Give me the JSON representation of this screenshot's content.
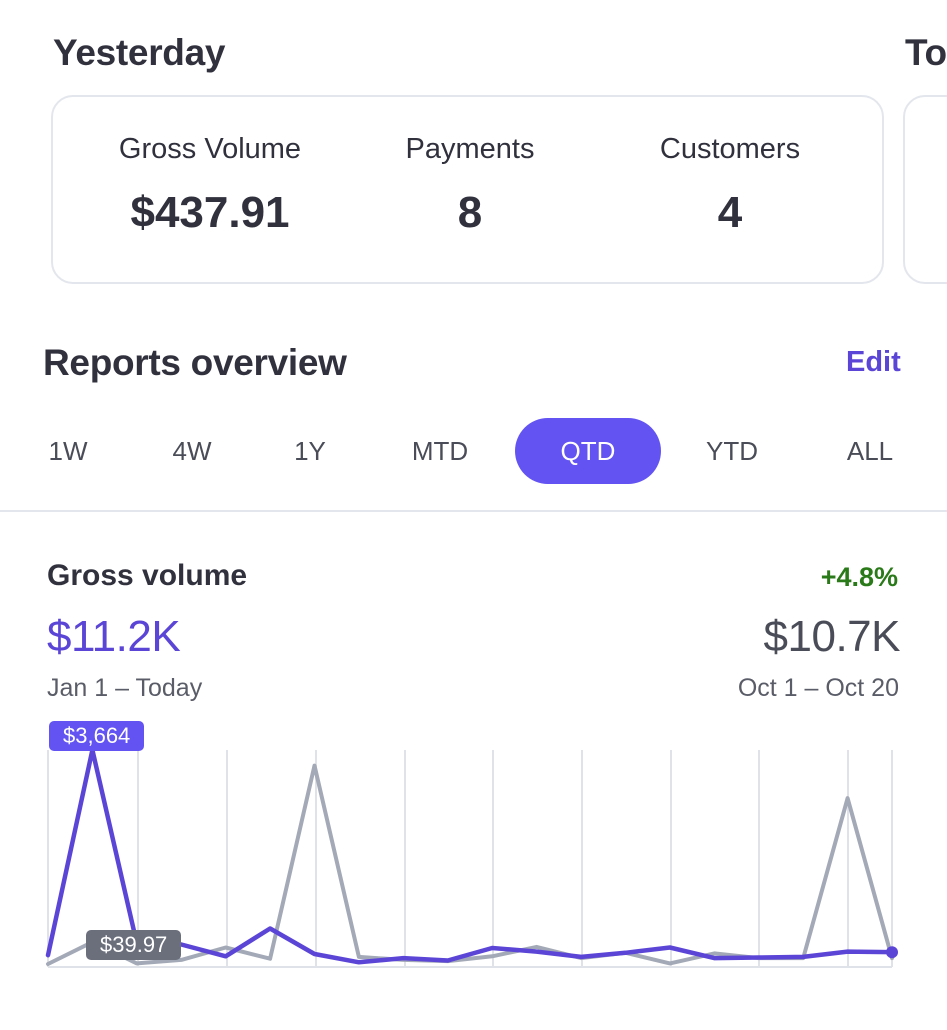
{
  "yesterday": {
    "title": "Yesterday",
    "next_title_peek": "To",
    "metrics": [
      {
        "label": "Gross Volume",
        "value": "$437.91"
      },
      {
        "label": "Payments",
        "value": "8"
      },
      {
        "label": "Customers",
        "value": "4"
      }
    ]
  },
  "reports": {
    "title": "Reports overview",
    "edit_label": "Edit",
    "tabs": [
      "1W",
      "4W",
      "1Y",
      "MTD",
      "QTD",
      "YTD",
      "ALL"
    ],
    "active_tab": "QTD"
  },
  "gross_volume": {
    "title": "Gross volume",
    "change": "+4.8%",
    "current_value": "$11.2K",
    "previous_value": "$10.7K",
    "current_range": "Jan 1 – Today",
    "previous_range": "Oct 1 – Oct 20",
    "current_tooltip": "$3,664",
    "previous_tooltip": "$39.97"
  },
  "colors": {
    "accent": "#6253f2",
    "current_line": "#5b45d6",
    "previous_line": "#a3a9b6",
    "positive": "#2b7a1a"
  },
  "chart_data": {
    "type": "line",
    "series": [
      {
        "values": [
          200,
          3664,
          400,
          380,
          180,
          650,
          220,
          80,
          150,
          110,
          320,
          260,
          170,
          240,
          330,
          150,
          160,
          170,
          260,
          250
        ]
      },
      {
        "values": [
          50,
          420,
          60,
          120,
          330,
          140,
          3400,
          170,
          120,
          100,
          180,
          340,
          150,
          240,
          60,
          230,
          150,
          150,
          2850,
          150
        ]
      }
    ]
  }
}
